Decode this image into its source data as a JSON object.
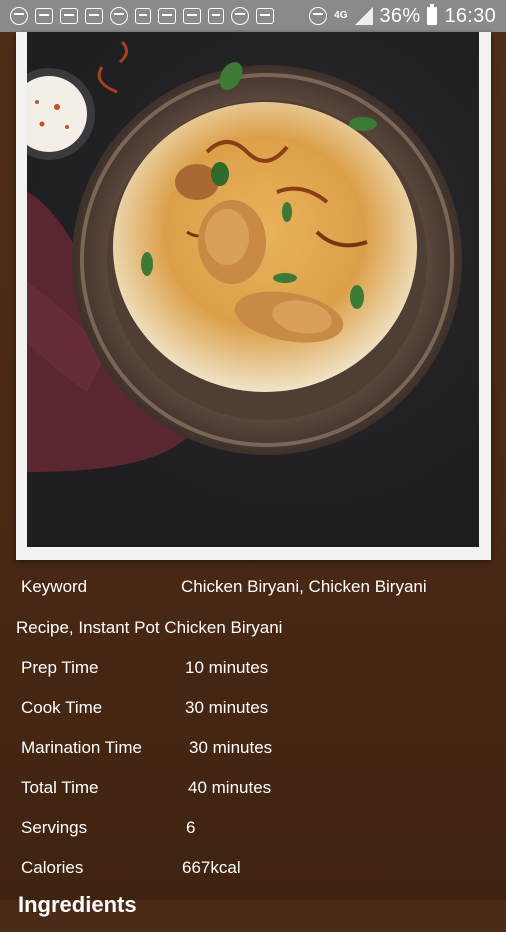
{
  "status_bar": {
    "network_text": "4G",
    "battery_percent": "36%",
    "time": "16:30"
  },
  "recipe_image": {
    "subject": "chicken-biryani-photo"
  },
  "details": {
    "keyword_label": "Keyword",
    "keyword_value_line1": "Chicken Biryani, Chicken Biryani",
    "keyword_value_line2": "Recipe, Instant Pot Chicken Biryani",
    "prep_label": "Prep Time",
    "prep_value": "10 minutes",
    "cook_label": "Cook Time",
    "cook_value": "30 minutes",
    "marination_label": "Marination Time",
    "marination_value": "30 minutes",
    "total_label": "Total Time",
    "total_value": "40 minutes",
    "servings_label": "Servings",
    "servings_value": "6",
    "calories_label": "Calories",
    "calories_value": "667kcal"
  },
  "ingredients_heading": "Ingredients"
}
